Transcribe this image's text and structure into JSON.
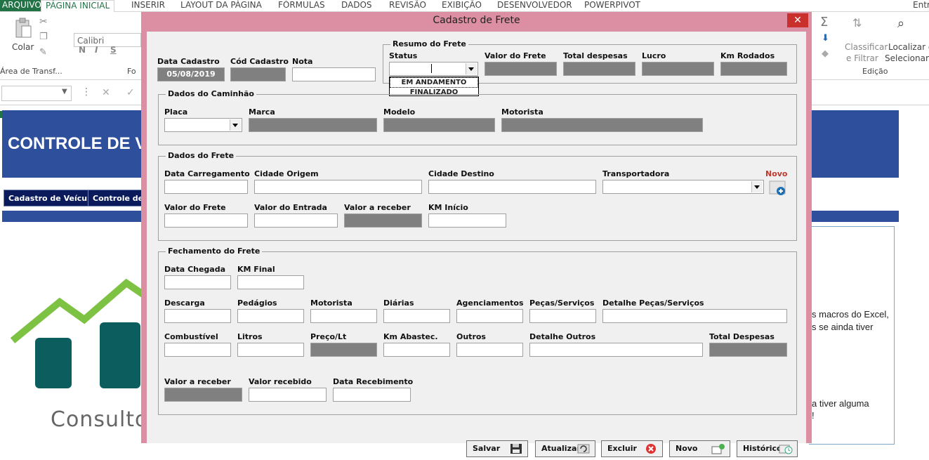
{
  "ribbon": {
    "tabs": [
      "ARQUIVO",
      "PÁGINA INICIAL",
      "INSERIR",
      "LAYOUT DA PÁGINA",
      "FÓRMULAS",
      "DADOS",
      "REVISÃO",
      "EXIBIÇÃO",
      "DESENVOLVEDOR",
      "POWERPIVOT",
      "Entra"
    ],
    "paste_label": "Colar",
    "clipboard_group": "Área de Transf...",
    "font_group": "Fo",
    "font_name": "Calibri",
    "bold": "N",
    "italic": "I",
    "underline": "S",
    "sort_label_1": "Classificar",
    "sort_label_2": "e Filtrar",
    "find_label_1": "Localizar e",
    "find_label_2": "Selecionar",
    "edit_group": "Edição"
  },
  "sheet": {
    "title": "CONTROLE DE VE",
    "btn_vehicles": "Cadastro de Veículos",
    "btn_control": "Controle de F",
    "text_line1": "s macros do Excel,",
    "text_line2": "s se ainda tiver",
    "text_line3": "a tiver alguma",
    "text_line4": "!",
    "logo_text": "Consultor"
  },
  "dialog": {
    "title": "Cadastro de Frete",
    "close": "✕",
    "header": {
      "date_label": "Data Cadastro",
      "date_value": "05/08/2019",
      "code_label": "Cód Cadastro",
      "note_label": "Nota"
    },
    "summary": {
      "title": "Resumo do Frete",
      "status_label": "Status",
      "status_options": [
        "EM ANDAMENTO",
        "FINALIZADO"
      ],
      "freight_value_label": "Valor do Frete",
      "total_expenses_label": "Total despesas",
      "profit_label": "Lucro",
      "km_label": "Km Rodados"
    },
    "truck": {
      "title": "Dados do Caminhão",
      "plate_label": "Placa",
      "brand_label": "Marca",
      "model_label": "Modelo",
      "driver_label": "Motorista"
    },
    "freight": {
      "title": "Dados do Frete",
      "load_date_label": "Data Carregamento",
      "origin_label": "Cidade Origem",
      "destination_label": "Cidade Destino",
      "carrier_label": "Transportadora",
      "new_label": "Novo",
      "freight_value_label": "Valor do Frete",
      "entry_value_label": "Valor do Entrada",
      "receivable_label": "Valor a receber",
      "km_start_label": "KM Início"
    },
    "closing": {
      "title": "Fechamento do Frete",
      "arrival_label": "Data Chegada",
      "km_end_label": "KM Final",
      "unloading_label": "Descarga",
      "tolls_label": "Pedágios",
      "driver_label": "Motorista",
      "daily_label": "Diárias",
      "agency_label": "Agenciamentos",
      "parts_label": "Peças/Serviços",
      "parts_detail_label": "Detalhe Peças/Serviços",
      "fuel_label": "Combustível",
      "liters_label": "Litros",
      "price_label": "Preço/Lt",
      "km_fuel_label": "Km Abastec.",
      "others_label": "Outros",
      "others_detail_label": "Detalhe Outros",
      "total_label": "Total Despesas",
      "receivable_label": "Valor a receber",
      "received_label": "Valor recebido",
      "receipt_date_label": "Data Recebimento"
    },
    "buttons": {
      "save": "Salvar",
      "update": "Atualizar",
      "delete": "Excluir",
      "new": "Novo",
      "history": "Histórico"
    }
  },
  "colors": {
    "excel_green": "#217346",
    "dialog_frame": "#dc8fa2",
    "readonly_field": "#808080",
    "sheet_blue": "#2e509c",
    "new_red": "#c0392b"
  }
}
